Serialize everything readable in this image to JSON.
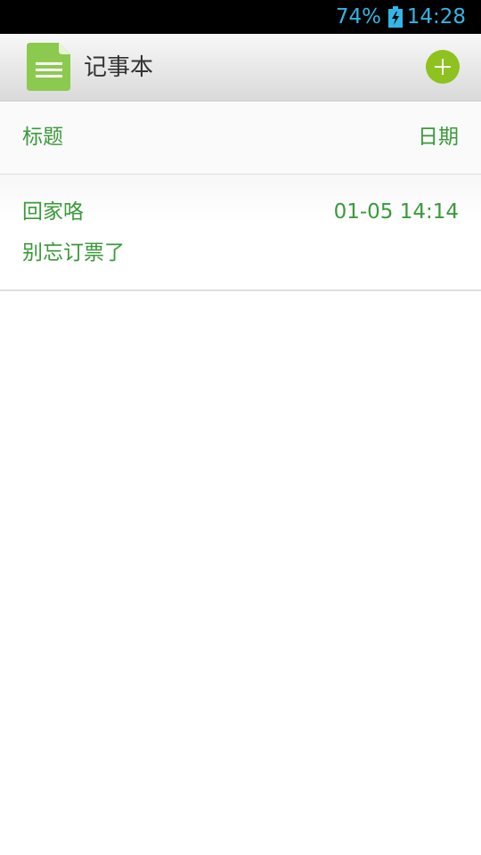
{
  "status_bar": {
    "battery_percent": "74%",
    "time": "14:28",
    "battery_icon": "battery-charging-icon",
    "color": "#34b5e5"
  },
  "app_bar": {
    "title": "记事本",
    "app_icon": "notepad-icon",
    "add_icon": "plus-circle-icon",
    "accent": "#8dc21f"
  },
  "list_header": {
    "title_label": "标题",
    "date_label": "日期"
  },
  "notes": [
    {
      "title": "回家咯",
      "date": "01-05 14:14",
      "body": "别忘订票了"
    }
  ],
  "text_color": "#3a9a3a"
}
